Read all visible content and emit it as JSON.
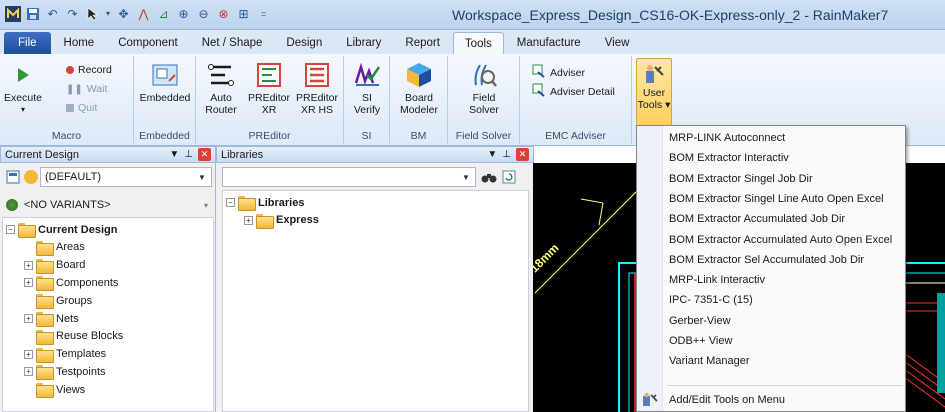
{
  "window": {
    "title": "Workspace_Express_Design_CS16-OK-Express-only_2 - RainMaker7"
  },
  "tabs": [
    {
      "label": "File"
    },
    {
      "label": "Home"
    },
    {
      "label": "Component"
    },
    {
      "label": "Net / Shape"
    },
    {
      "label": "Design"
    },
    {
      "label": "Library"
    },
    {
      "label": "Report"
    },
    {
      "label": "Tools"
    },
    {
      "label": "Manufacture"
    },
    {
      "label": "View"
    }
  ],
  "active_tab": "Tools",
  "ribbon": {
    "macro": {
      "group_label": "Macro",
      "execute": "Execute",
      "record": "Record",
      "wait": "Wait",
      "quit": "Quit"
    },
    "embedded": {
      "group_label": "Embedded",
      "button": "Embedded"
    },
    "preditor": {
      "group_label": "PREditor",
      "auto_router_1": "Auto",
      "auto_router_2": "Router",
      "preditor_xr_1": "PREditor",
      "preditor_xr_2": "XR",
      "preditor_xrhs_1": "PREditor",
      "preditor_xrhs_2": "XR HS"
    },
    "si": {
      "group_label": "SI",
      "line1": "SI",
      "line2": "Verify"
    },
    "bm": {
      "group_label": "BM",
      "line1": "Board",
      "line2": "Modeler"
    },
    "field_solver": {
      "group_label": "Field Solver",
      "line1": "Field",
      "line2": "Solver"
    },
    "emc": {
      "group_label": "EMC Adviser",
      "adviser": "Adviser",
      "adviser_detail": "Adviser Detail"
    },
    "user_tools": {
      "line1": "User",
      "line2": "Tools ▾"
    }
  },
  "current_design_panel": {
    "title": "Current Design",
    "design_combo": "(DEFAULT)",
    "variants_combo": "<NO VARIANTS>",
    "tree": [
      {
        "label": "Current Design",
        "level": 0,
        "expander": "−",
        "bold": true
      },
      {
        "label": "Areas",
        "level": 1,
        "expander": ""
      },
      {
        "label": "Board",
        "level": 1,
        "expander": "+"
      },
      {
        "label": "Components",
        "level": 1,
        "expander": "+"
      },
      {
        "label": "Groups",
        "level": 1,
        "expander": ""
      },
      {
        "label": "Nets",
        "level": 1,
        "expander": "+"
      },
      {
        "label": "Reuse Blocks",
        "level": 1,
        "expander": ""
      },
      {
        "label": "Templates",
        "level": 1,
        "expander": "+"
      },
      {
        "label": "Testpoints",
        "level": 1,
        "expander": "+"
      },
      {
        "label": "Views",
        "level": 1,
        "expander": ""
      }
    ]
  },
  "libraries_panel": {
    "title": "Libraries",
    "search_value": "",
    "tree": [
      {
        "label": "Libraries",
        "level": 0,
        "expander": "−",
        "bold": true
      },
      {
        "label": "Express",
        "level": 1,
        "expander": "+",
        "bold": true
      }
    ]
  },
  "canvas": {
    "dimension_text": "18mm",
    "colors": {
      "background": "#000000",
      "board": "#00ffff",
      "copper": "#ff3030",
      "dimension": "#ffff80"
    }
  },
  "user_tools_menu": {
    "items": [
      "MRP-LINK Autoconnect",
      "BOM Extractor Interactiv",
      "BOM Extractor Singel  Job Dir",
      "BOM Extractor Singel Line Auto Open Excel",
      "BOM Extractor Accumulated Job Dir",
      "BOM Extractor Accumulated Auto Open Excel",
      "BOM Extractor Sel Accumulated Job Dir",
      "MRP-Link Interactiv",
      "IPC- 7351-C (15)",
      "Gerber-View",
      "ODB++ View",
      "Variant Manager"
    ],
    "footer_item": "Add/Edit Tools on Menu"
  }
}
